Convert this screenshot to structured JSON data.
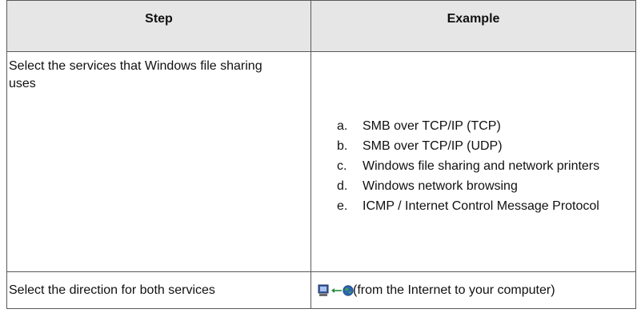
{
  "table": {
    "headers": {
      "step": "Step",
      "example": "Example"
    },
    "rows": [
      {
        "step": "Select the services that Windows file sharing uses",
        "options": [
          {
            "letter": "a.",
            "text": "SMB over TCP/IP (TCP)"
          },
          {
            "letter": "b.",
            "text": "SMB over TCP/IP (UDP)"
          },
          {
            "letter": "c.",
            "text": "Windows file sharing and network printers"
          },
          {
            "letter": "d.",
            "text": "Windows network browsing"
          },
          {
            "letter": "e.",
            "text": "ICMP / Internet Control Message Protocol"
          }
        ]
      },
      {
        "step": "Select the direction for both services",
        "example": {
          "icons": [
            "computer-icon",
            "arrow-left-icon",
            "globe-icon"
          ],
          "text": "(from the Internet to your computer)"
        }
      }
    ]
  },
  "colors": {
    "header_background": "#e6e6e6",
    "border": "#5a5a5a",
    "arrow": "#1f8f3a",
    "globe": "#2a66b8",
    "computer": "#3b5fa8"
  }
}
